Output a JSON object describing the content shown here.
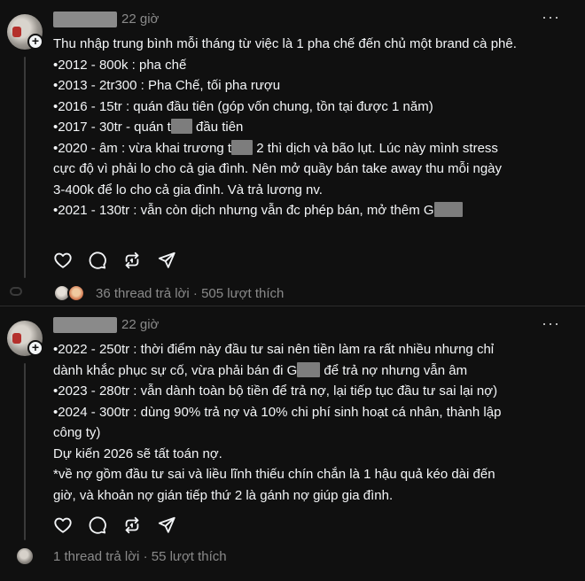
{
  "post1": {
    "time": "22 giờ",
    "more": "···",
    "lines": [
      "Thu nhập trung bình mỗi tháng từ việc là 1 pha chế đến chủ một brand cà phê.",
      "•2012 - 800k : pha chế",
      "•2013 - 2tr300 : Pha Chế, tối pha rượu",
      "•2016 - 15tr : quán đầu tiên (góp vốn chung, tồn tại được 1 năm)"
    ],
    "line_2017_a": "•2017 - 30tr - quán t",
    "line_2017_b": " đầu tiên",
    "line_2020_a": "•2020 - âm : vừa khai trương t",
    "line_2020_b": " 2 thì dịch và bão lụt. Lúc này mình stress",
    "line_2020_c": "cực độ vì phải lo cho cả gia đình. Nên mở quầy bán take away thu mỗi ngày",
    "line_2020_d": "3-400k để lo cho cả gia đình. Và trả lương nv.",
    "line_2021_a": "•2021 - 130tr : vẫn còn dịch nhưng vẫn đc phép bán, mở thêm G",
    "replies": "36 thread trả lời",
    "sep": "·",
    "likes": "505 lượt thích"
  },
  "post2": {
    "time": "22 giờ",
    "more": "···",
    "line_2022_a": "•2022 - 250tr : thời điểm này đầu tư sai nên tiền làm ra rất nhiều nhưng chỉ",
    "line_2022_b": "dành khắc phục sự cố, vừa phải bán đi G",
    "line_2022_c": " để trả nợ nhưng vẫn âm",
    "lines": [
      "•2023 - 280tr : vẫn dành toàn bộ tiền để trả nợ, lại tiếp tục đầu tư sai lại nợ)",
      "•2024 - 300tr : dùng 90% trả nợ và 10% chi phí sinh hoạt cá nhân, thành lập",
      "công ty)",
      "Dự kiến 2026 sẽ tất toán nợ.",
      "*về nợ gồm đầu tư sai và liều lĩnh thiếu chín chắn là 1 hậu quả kéo dài đến",
      "giờ, và khoản nợ gián tiếp thứ 2 là gánh nợ giúp gia đình."
    ],
    "replies": "1 thread trả lời",
    "sep": "·",
    "likes": "55 lượt thích"
  },
  "icons": [
    "heart-icon",
    "comment-icon",
    "repost-icon",
    "share-icon",
    "more-icon",
    "follow-plus-icon"
  ],
  "colors": {
    "background": "#101010",
    "text": "#f3f5f7",
    "muted": "#8a8a8a"
  }
}
